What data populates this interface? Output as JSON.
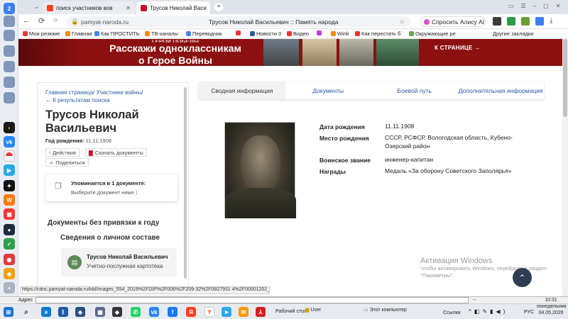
{
  "browser": {
    "tab_count": "2",
    "tabs": [
      {
        "label": "поиск участников вов",
        "active": false
      },
      {
        "label": "Трусов Николай Васи",
        "active": true
      }
    ],
    "url": "pamyat-naroda.ru",
    "page_title": "Трусов Николай Васильевич :: Память народа",
    "alisa": "Спросить Алису AI",
    "bookmarks": [
      "Мои резюме",
      "Главная",
      "Как ПРОСТИТЬ",
      "ТВ-каналы",
      "Переводчик",
      "",
      "Новости 0",
      "Видео",
      "",
      "Wink",
      "Как перестать б",
      "Окружающие ре"
    ],
    "other_bookmarks": "Другие закладки"
  },
  "banner": {
    "line0": "ГЕРОИ ПОБЕДЫ",
    "line1": "Расскажи одноклассникам",
    "line2": "о Герое Войны",
    "cta": "К СТРАНИЦЕ →"
  },
  "sidebar": {
    "crumb1": "Главная страница",
    "crumb2": "Участники войны",
    "back": "← К результатам поиска",
    "name": "Трусов Николай Васильевич",
    "dob_label": "Год рождения:",
    "dob_value": "11.11.1908",
    "actions": "Действия",
    "download": "Скачать документы",
    "share": "Поделиться",
    "mention_title": "Упоминается в 1 документе:",
    "mention_sub": "Выберите документ ниже ↓",
    "docs_unlinked": "Документы без привязки к году",
    "section": "Сведения о личном составе",
    "card_name": "Трусов Николай Васильевич",
    "card_type": "Учетно-послужная картотека"
  },
  "tabs": [
    "Сводная информация",
    "Документы",
    "Боевой путь",
    "Дополнительная информация"
  ],
  "info": [
    {
      "k": "Дата рождения",
      "v": "11.11.1908"
    },
    {
      "k": "Место рождения",
      "v": "СССР, РСФСР, Вологодская область, Кубено-Озерский район"
    },
    {
      "k": "Воинское звание",
      "v": "инженер-капитан"
    },
    {
      "k": "Награды",
      "v": "Медаль «За оборону Советского Заполярья»"
    }
  ],
  "watermark": {
    "title": "Активация Windows",
    "sub": "Чтобы активировать Windows, перейдите в раздел \"Параметры\"."
  },
  "status_url": "https://cdnc.pamyat-naroda.ru/kld/Images_554_2019%2FDIP%2F006%2F209-32%2F0927931 4%2F00001202_photo.jpg",
  "taskbar": {
    "address_label": "Адрес",
    "desktop": "Рабочий стол",
    "user": "User",
    "computer": "Этот компьютер",
    "links": "Ссылки",
    "lang": "РУС",
    "time": "10:31",
    "day": "понедельник",
    "date": "04.05.2026"
  }
}
